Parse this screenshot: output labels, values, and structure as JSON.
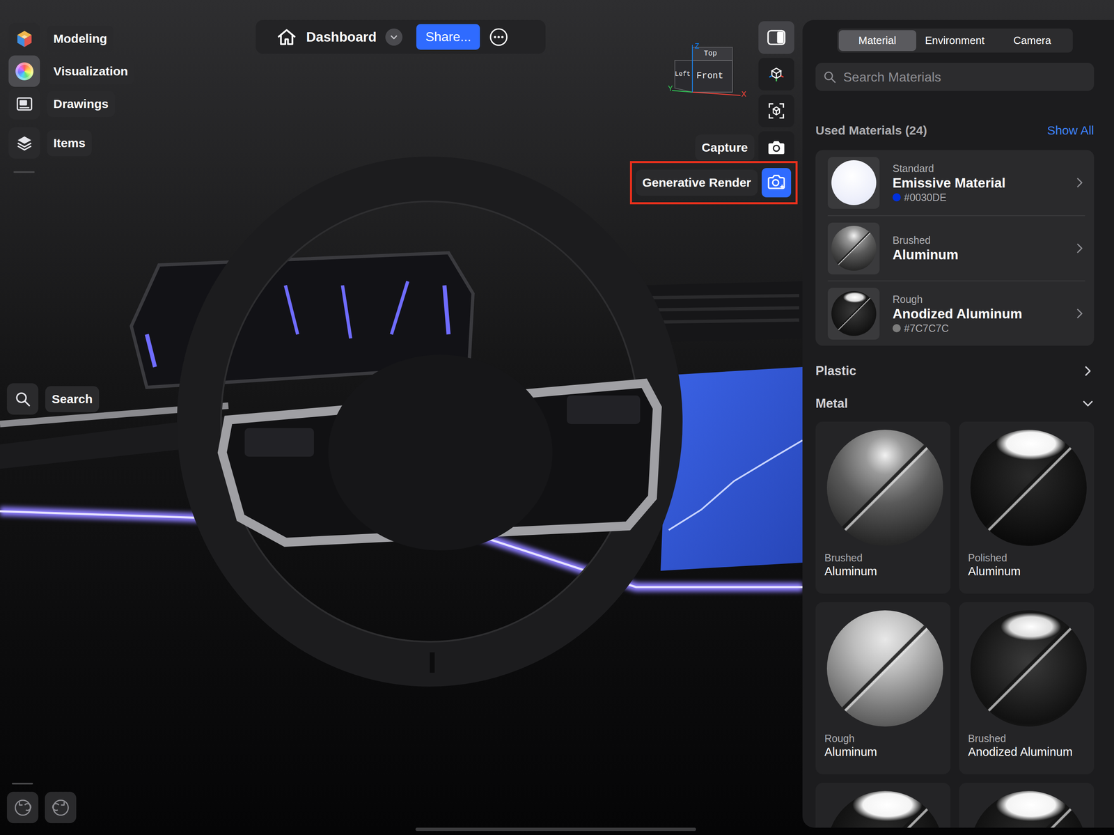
{
  "toolbar": {
    "items": [
      {
        "label": "Modeling",
        "selected": false
      },
      {
        "label": "Visualization",
        "selected": true
      },
      {
        "label": "Drawings",
        "selected": false
      },
      {
        "label": "Items",
        "selected": false
      }
    ],
    "search": "Search"
  },
  "document": {
    "title": "Dashboard",
    "share": "Share..."
  },
  "view_cube": {
    "top": "Top",
    "left": "Left",
    "front": "Front",
    "x": "X",
    "y": "Y",
    "z": "Z"
  },
  "tools": {
    "panel_open": true,
    "capture": "Capture",
    "generative_render": "Generative Render",
    "generative_selected": true,
    "generative_highlighted": true
  },
  "panel": {
    "tabs": [
      {
        "label": "Material",
        "selected": true
      },
      {
        "label": "Environment",
        "selected": false
      },
      {
        "label": "Camera",
        "selected": false
      }
    ],
    "search": {
      "placeholder": "Search Materials"
    },
    "used": {
      "title": "Used Materials (24)",
      "show_all": "Show All",
      "items": [
        {
          "type": "Standard",
          "name": "Emissive Material",
          "hex": "#0030DE",
          "color": "#0030DE",
          "kind": "emissive"
        },
        {
          "type": "Brushed",
          "name": "Aluminum",
          "kind": "brushed"
        },
        {
          "type": "Rough",
          "name": "Anodized Aluminum",
          "hex": "#7C7C7C",
          "color": "#7C7C7C",
          "kind": "anodized"
        }
      ]
    },
    "sections": [
      {
        "label": "Plastic",
        "expanded": false
      },
      {
        "label": "Metal",
        "expanded": true
      }
    ],
    "metal": [
      {
        "type": "Brushed",
        "name": "Aluminum",
        "kind": "brushed"
      },
      {
        "type": "Polished",
        "name": "Aluminum",
        "kind": "polished"
      },
      {
        "type": "Rough",
        "name": "Aluminum",
        "kind": "rough"
      },
      {
        "type": "Brushed",
        "name": "Anodized Aluminum",
        "kind": "anodized"
      },
      {
        "kind": "polished"
      },
      {
        "kind": "polished"
      }
    ]
  }
}
